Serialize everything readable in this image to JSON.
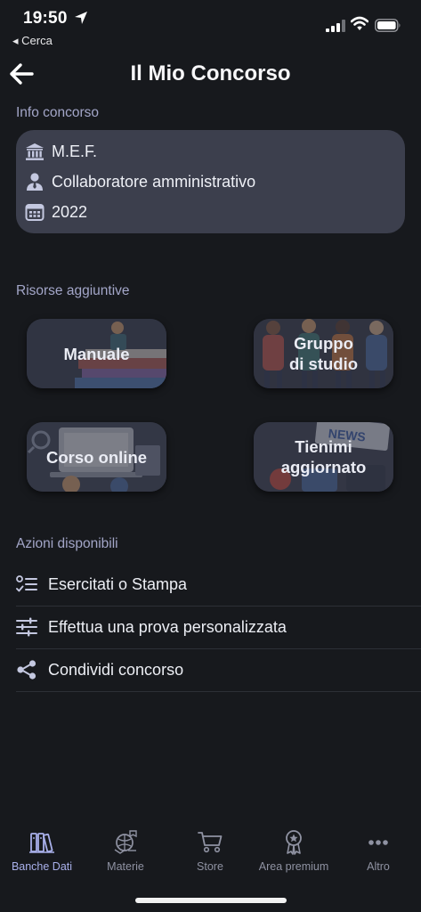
{
  "status_bar": {
    "time": "19:50",
    "back_app": "◂ Cerca"
  },
  "header": {
    "title": "Il Mio Concorso"
  },
  "info": {
    "section_label": "Info concorso",
    "ente": "M.E.F.",
    "profilo": "Collaboratore amministrativo",
    "anno": "2022"
  },
  "risorse": {
    "section_label": "Risorse aggiuntive",
    "manuale": "Manuale",
    "gruppo": "Gruppo\ndi studio",
    "corso": "Corso online",
    "tienimi": "Tienimi\naggiornato"
  },
  "azioni": {
    "section_label": "Azioni disponibili",
    "items": [
      {
        "label": "Esercitati o Stampa",
        "icon": "checklist-icon"
      },
      {
        "label": "Effettua una prova personalizzata",
        "icon": "sliders-icon"
      },
      {
        "label": "Condividi concorso",
        "icon": "share-icon"
      }
    ]
  },
  "tabbar": {
    "items": [
      {
        "label": "Banche Dati",
        "icon": "books-icon",
        "active": true
      },
      {
        "label": "Materie",
        "icon": "subjects-icon",
        "active": false
      },
      {
        "label": "Store",
        "icon": "cart-icon",
        "active": false
      },
      {
        "label": "Area premium",
        "icon": "award-icon",
        "active": false
      },
      {
        "label": "Altro",
        "icon": "more-icon",
        "active": false
      }
    ]
  },
  "colors": {
    "background": "#17191d",
    "card": "#3c3f4d",
    "section_label": "#a3a6c8",
    "tab_active": "#a9b0ea",
    "tab_inactive": "#8f92a2"
  }
}
